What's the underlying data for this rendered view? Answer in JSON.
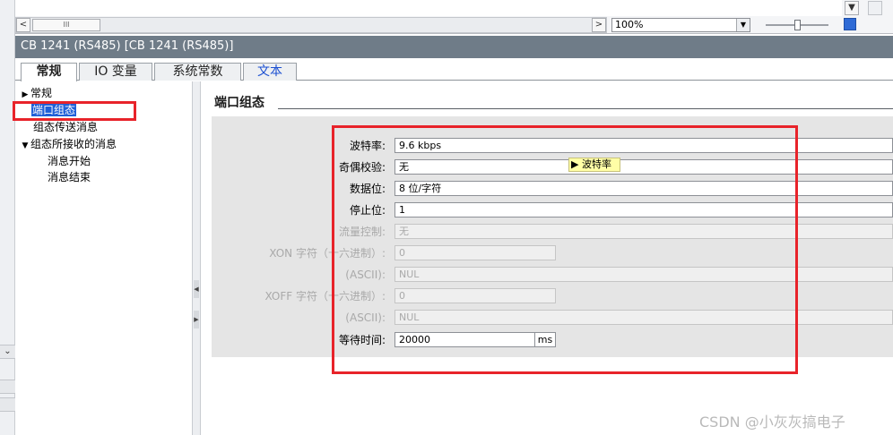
{
  "toolbar": {
    "scroll_left": "<",
    "scroll_thumb": "III",
    "scroll_right": ">",
    "zoom_value": "100%",
    "dropdown_glyph": "▼"
  },
  "title_bar": "CB 1241 (RS485) [CB 1241 (RS485)]",
  "tabs": [
    {
      "label": "常规"
    },
    {
      "label": "IO 变量"
    },
    {
      "label": "系统常数"
    },
    {
      "label": "文本"
    }
  ],
  "nav": {
    "items": [
      {
        "label": "常规",
        "caret": "▶"
      },
      {
        "label": "端口组态"
      },
      {
        "label": "组态传送消息"
      },
      {
        "label": "组态所接收的消息",
        "caret": "▼"
      },
      {
        "label": "消息开始"
      },
      {
        "label": "消息结束"
      }
    ]
  },
  "section_title": "端口组态",
  "form": {
    "rows": [
      {
        "label": "波特率:",
        "value": "9.6 kbps"
      },
      {
        "label": "奇偶校验:",
        "value": "无"
      },
      {
        "label": "数据位:",
        "value": "8 位/字符"
      },
      {
        "label": "停止位:",
        "value": "1"
      },
      {
        "label": "流量控制:",
        "value": "无"
      },
      {
        "label": "XON 字符（十六进制）:",
        "value": "0"
      },
      {
        "label": "(ASCII):",
        "value": "NUL"
      },
      {
        "label": "XOFF 字符（十六进制）:",
        "value": "0"
      },
      {
        "label": "(ASCII):",
        "value": "NUL"
      },
      {
        "label": "等待时间:",
        "value": "20000"
      }
    ],
    "wait_unit": "ms"
  },
  "tooltip": "▶ 波特率",
  "watermark": "CSDN @小灰灰搞电子",
  "colors": {
    "title_bar": "#6f7c88",
    "selection": "#1f60d8",
    "annotation": "#e8232a",
    "panel": "#e5e5e5",
    "link_tab": "#1b4fd1"
  }
}
